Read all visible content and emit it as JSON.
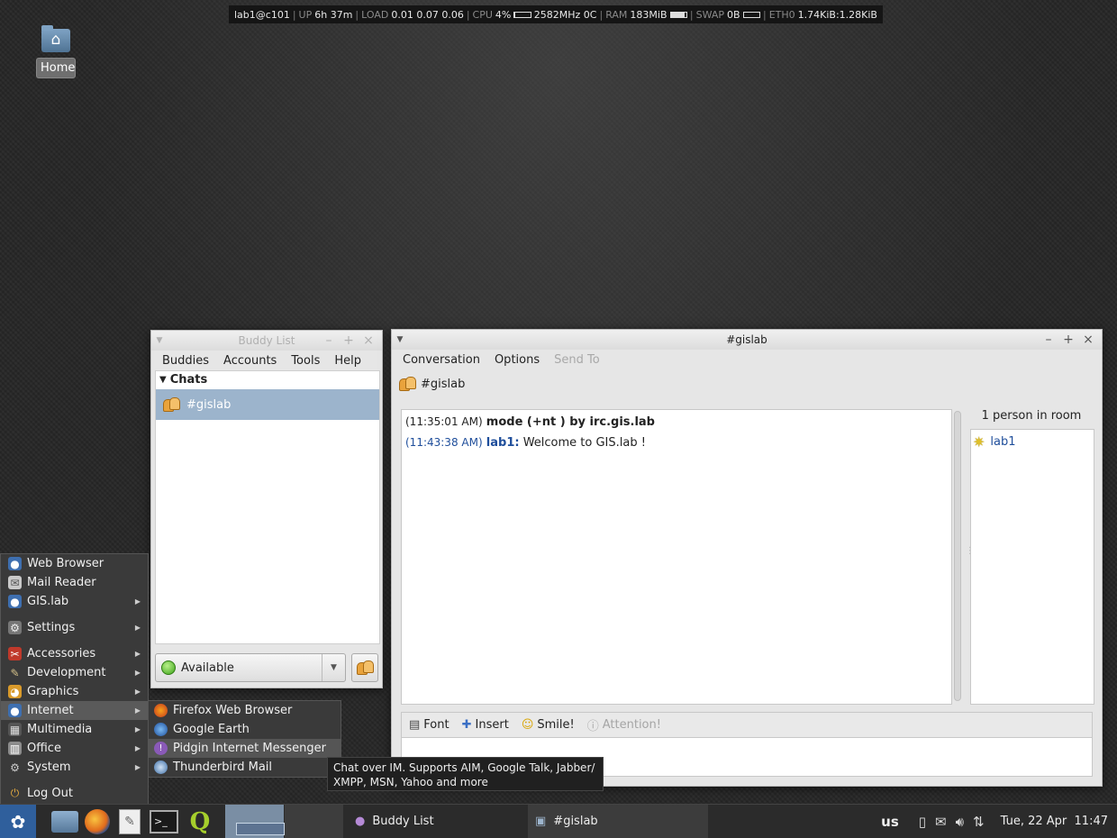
{
  "conky": {
    "user_host": "lab1@c101",
    "up_label": "UP",
    "up_value": "6h 37m",
    "load_label": "LOAD",
    "load_value": "0.01 0.07 0.06",
    "cpu_label": "CPU",
    "cpu_value": "4%",
    "cpu_bar_fraction": 0.04,
    "cpu_freq": "2582MHz 0C",
    "ram_label": "RAM",
    "ram_value": "183MiB",
    "ram_bar_fraction": 0.9,
    "swap_label": "SWAP",
    "swap_value": "0B",
    "swap_bar_fraction": 0.0,
    "eth_label": "ETH0",
    "eth_value": "1.74KiB:1.28KiB"
  },
  "desktop": {
    "home_label": "Home",
    "home_icon": "home-folder-icon"
  },
  "buddy_window": {
    "title": "Buddy List",
    "menu": [
      "Buddies",
      "Accounts",
      "Tools",
      "Help"
    ],
    "group_label": "Chats",
    "chat_item": "#gislab",
    "status": "Available"
  },
  "chat_window": {
    "title": "#gislab",
    "menu": [
      "Conversation",
      "Options",
      "Send To"
    ],
    "tab_label": "#gislab",
    "messages": [
      {
        "time": "(11:35:01 AM)",
        "nick": "",
        "text": "mode (+nt ) by irc.gis.lab"
      },
      {
        "time": "(11:43:38 AM)",
        "nick": "lab1:",
        "text": "Welcome to GIS.lab !"
      }
    ],
    "people_count": "1 person in room",
    "people": [
      "lab1"
    ],
    "toolbar": {
      "font": "Font",
      "insert": "Insert",
      "smile": "Smile!",
      "attention": "Attention!"
    }
  },
  "app_menu": {
    "items": [
      {
        "label": "Web Browser",
        "icon": "globe-icon",
        "submenu": false
      },
      {
        "label": "Mail Reader",
        "icon": "mail-icon",
        "submenu": false
      },
      {
        "label": "GIS.lab",
        "icon": "globe-icon",
        "submenu": true
      },
      {
        "label": "Settings",
        "icon": "settings-icon",
        "submenu": true
      },
      {
        "label": "Accessories",
        "icon": "accessories-icon",
        "submenu": true
      },
      {
        "label": "Development",
        "icon": "development-icon",
        "submenu": true
      },
      {
        "label": "Graphics",
        "icon": "graphics-icon",
        "submenu": true
      },
      {
        "label": "Internet",
        "icon": "globe-icon",
        "submenu": true
      },
      {
        "label": "Multimedia",
        "icon": "multimedia-icon",
        "submenu": true
      },
      {
        "label": "Office",
        "icon": "office-icon",
        "submenu": true
      },
      {
        "label": "System",
        "icon": "gear-icon",
        "submenu": true
      },
      {
        "label": "Log Out",
        "icon": "logout-icon",
        "submenu": false
      }
    ],
    "internet_submenu": [
      "Firefox Web Browser",
      "Google Earth",
      "Pidgin Internet Messenger",
      "Thunderbird Mail"
    ]
  },
  "tooltip": {
    "line1": "Chat over IM.  Supports AIM, Google Talk, Jabber/",
    "line2": "XMPP, MSN, Yahoo and more"
  },
  "panel": {
    "tasks": [
      "Buddy List",
      "#gislab"
    ],
    "keyboard_layout": "us",
    "clock": "Tue, 22 Apr  11:47"
  },
  "colors": {
    "selection": "#9cb4cc",
    "link_blue": "#1f4e9b",
    "menu_bg": "#3a3a3a"
  }
}
